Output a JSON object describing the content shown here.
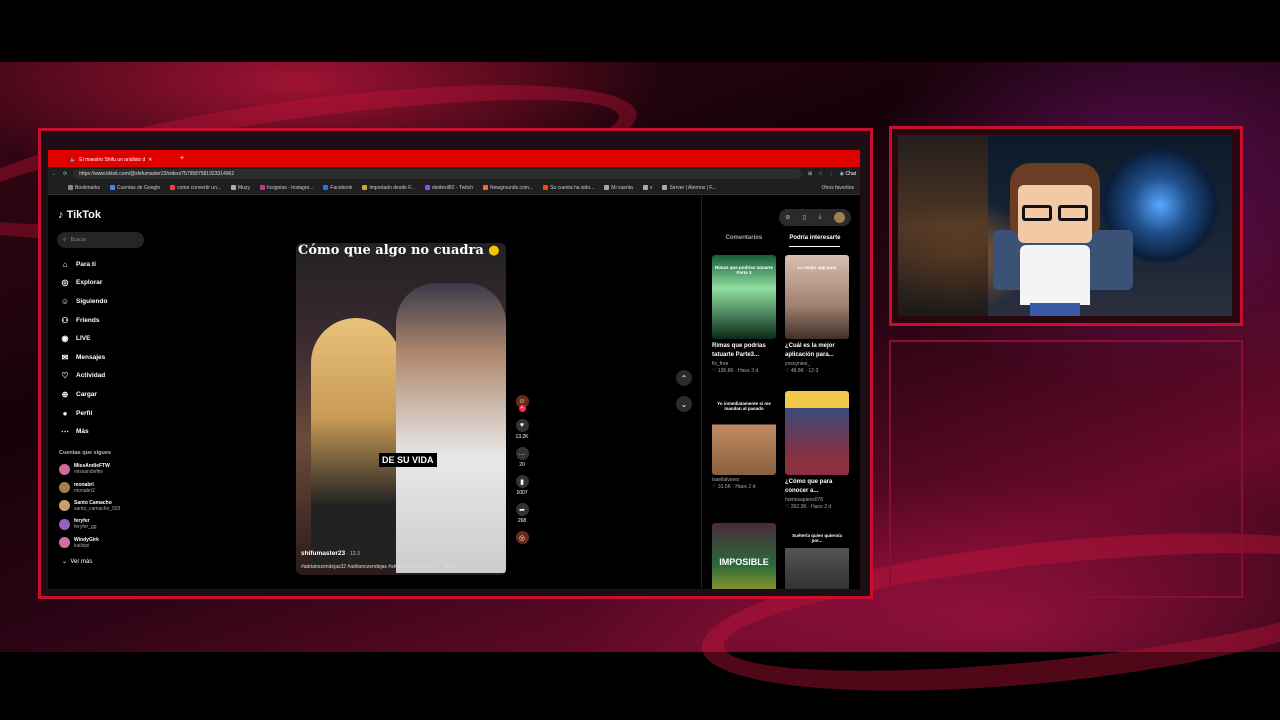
{
  "browser": {
    "tab_title": "El maestro Shifu un análisis d",
    "url": "https://www.tiktok.com/@shifumaster23/video/7579587581923314962",
    "chat_label": "Chat",
    "bookmarks": [
      "Bookmarks",
      "Cuentas de Google",
      "como convertir un...",
      "Muzy",
      "Insignias - Instagra...",
      "Facebook",
      "Importado desde F...",
      "deidevil82 - Twitch",
      "Newgrounds.com...",
      "Su cuenta ha sido...",
      "Mi cuenta",
      "v",
      "Server | Aternos | F..."
    ],
    "other_bookmarks": "Otros favoritos"
  },
  "tiktok": {
    "logo": "TikTok",
    "search_placeholder": "Buscar",
    "nav": [
      "Para ti",
      "Explorar",
      "Siguiendo",
      "Friends",
      "LIVE",
      "Mensajes",
      "Actividad",
      "Cargar",
      "Perfil",
      "Más"
    ],
    "following_title": "Cuentas que sigues",
    "following": [
      {
        "name": "MissAndieFTW",
        "handle": "missandieftw"
      },
      {
        "name": "monabri",
        "handle": "monabri2"
      },
      {
        "name": "Santo Camacho",
        "handle": "santo_camacho_593"
      },
      {
        "name": "feryfer",
        "handle": "feryfer_gg"
      },
      {
        "name": "WindyGirk",
        "handle": "katlispi"
      }
    ],
    "see_more": "Ver más",
    "video": {
      "title": "Cómo que algo no cuadra",
      "caption": "DE SU VIDA",
      "author": "shifumaster23",
      "date": "· 12-3",
      "tags": "#adrianozendejas32 #adrianozendejas #shifu #maestroshifu ...",
      "more": "más",
      "likes": "13.2K",
      "comments": "20",
      "saves": "1007",
      "shares": "268"
    },
    "right_tabs": [
      "Comentarios",
      "Podría interesarte"
    ],
    "cards": [
      {
        "title": "Rimas que podrías tatuarte Parte3...",
        "author": "fiz_free",
        "meta": "♡ 136.6K · Hace 3 d",
        "overlay": "Rimas que podrías tatuarte Parte 3"
      },
      {
        "title": "¿Cuál es la mejor aplicación para...",
        "author": "yosoyniee_",
        "meta": "♡ 48.8K · 12-3",
        "overlay": "La mejor app para"
      },
      {
        "title": "",
        "author": "isaellalvarez",
        "meta": "♡ 31.5K · Hace 2 d",
        "overlay": "Yo inmediatamente si me mandan al pasado"
      },
      {
        "title": "¿Cómo que para conocer a...",
        "author": "homosapiens078",
        "meta": "♡ 262.3K · Hace 2 d",
        "overlay": ""
      },
      {
        "title": "",
        "author": "",
        "meta": "",
        "overlay": "IMPOSIBLE"
      },
      {
        "title": "",
        "author": "",
        "meta": "",
        "overlay": "Suéter/a quien quiero/a por..."
      }
    ]
  },
  "colors": {
    "tab_red": "#e00000",
    "frame_red": "#c8102e",
    "background": "#000000"
  }
}
